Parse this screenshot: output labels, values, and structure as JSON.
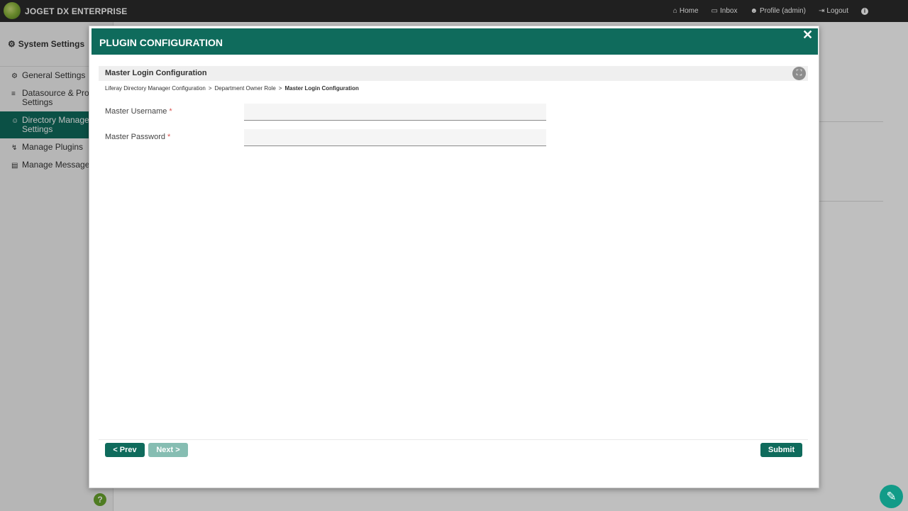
{
  "topbar": {
    "brand": "JOGET DX ENTERPRISE",
    "nav": [
      {
        "icon": "home-icon",
        "glyph": "⌂",
        "label": "Home"
      },
      {
        "icon": "inbox-icon",
        "glyph": "▭",
        "label": "Inbox"
      },
      {
        "icon": "user-icon",
        "glyph": "☻",
        "label": "Profile (admin)"
      },
      {
        "icon": "logout-icon",
        "glyph": "⇥",
        "label": "Logout"
      }
    ],
    "info_glyph": "i"
  },
  "sidebar": {
    "title": "System Settings",
    "title_glyph": "⚙",
    "items": [
      {
        "glyph": "⚙",
        "label": "General Settings"
      },
      {
        "glyph": "≡",
        "label": "Datasource & Profi\nSettings"
      },
      {
        "glyph": "☺",
        "label": "Directory Manager\nSettings"
      },
      {
        "glyph": "↯",
        "label": "Manage Plugins"
      },
      {
        "glyph": "▤",
        "label": "Manage Messages"
      }
    ],
    "active_index": 2,
    "help_glyph": "?"
  },
  "modal": {
    "title": "PLUGIN CONFIGURATION",
    "close_glyph": "✕",
    "section_title": "Master Login Configuration",
    "fullscreen_glyph": "⛶",
    "breadcrumb": {
      "items": [
        "Liferay Directory Manager Configuration",
        "Department Owner Role"
      ],
      "separator": ">",
      "current": "Master Login Configuration"
    },
    "fields": [
      {
        "label": "Master Username",
        "required_mark": "*",
        "value": ""
      },
      {
        "label": "Master Password",
        "required_mark": "*",
        "value": ""
      }
    ],
    "buttons": {
      "prev": "< Prev",
      "next": "Next >",
      "submit": "Submit"
    }
  },
  "edit_glyph": "✎",
  "colors": {
    "primary": "#0f6b5c",
    "topbar": "#2b2b2b",
    "disabled_button": "#86bdb2"
  }
}
